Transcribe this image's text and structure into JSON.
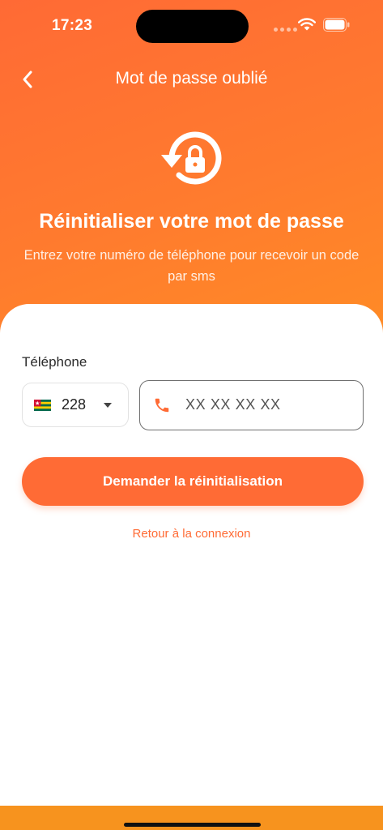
{
  "status_bar": {
    "time": "17:23"
  },
  "nav": {
    "title": "Mot de passe oublié",
    "back_icon": "chevron-left-icon"
  },
  "hero": {
    "icon": "lock-reset-icon",
    "title": "Réinitialiser votre mot de passe",
    "subtitle": "Entrez votre numéro de téléphone pour recevoir un code par sms"
  },
  "form": {
    "phone_label": "Téléphone",
    "country": {
      "flag": "togo-flag-icon",
      "code": "228"
    },
    "phone_input": {
      "value": "",
      "placeholder": "XX XX XX XX"
    },
    "submit_label": "Demander la réinitialisation",
    "back_link": "Retour à la connexion"
  },
  "colors": {
    "primary": "#ff6b35",
    "header_gradient_start": "#ff6a35",
    "header_gradient_end": "#ff8c25",
    "bottom_strip": "#f7931e"
  }
}
